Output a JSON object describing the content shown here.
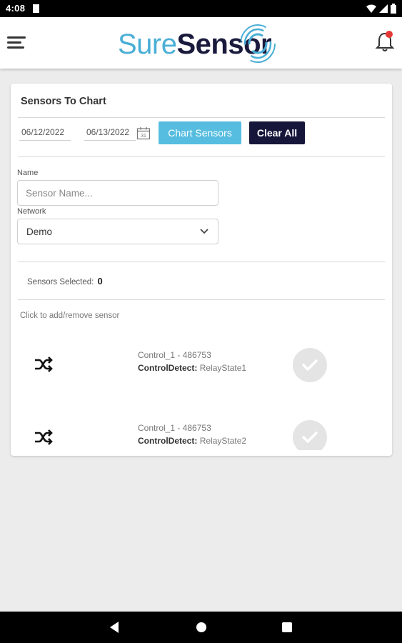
{
  "status_bar": {
    "time": "4:08",
    "icons": [
      "sd-card-icon",
      "wifi-icon",
      "signal-icon",
      "battery-icon"
    ]
  },
  "header": {
    "logo_part1": "Sure",
    "logo_part2": "Sensor",
    "colors": {
      "logo_light": "#4aaed6",
      "logo_dark": "#1a1a3d",
      "notification_dot": "#e53935"
    }
  },
  "card": {
    "title": "Sensors To Chart",
    "start_date": "06/12/2022",
    "end_date": "06/13/2022",
    "chart_button": "Chart Sensors",
    "clear_button": "Clear All",
    "name_label": "Name",
    "name_placeholder": "Sensor Name...",
    "network_label": "Network",
    "network_value": "Demo",
    "selected_label": "Sensors Selected:",
    "selected_count": "0",
    "hint": "Click to add/remove sensor",
    "colors": {
      "chart_button": "#56bde0",
      "clear_button": "#16153a"
    }
  },
  "sensors": [
    {
      "device": "Control_1 - 486753",
      "type": "ControlDetect:",
      "state": "RelayState1",
      "selected": false
    },
    {
      "device": "Control_1 - 486753",
      "type": "ControlDetect:",
      "state": "RelayState2",
      "selected": false
    }
  ],
  "nav_bar": {
    "icons": [
      "back-icon",
      "home-icon",
      "recents-icon"
    ]
  }
}
